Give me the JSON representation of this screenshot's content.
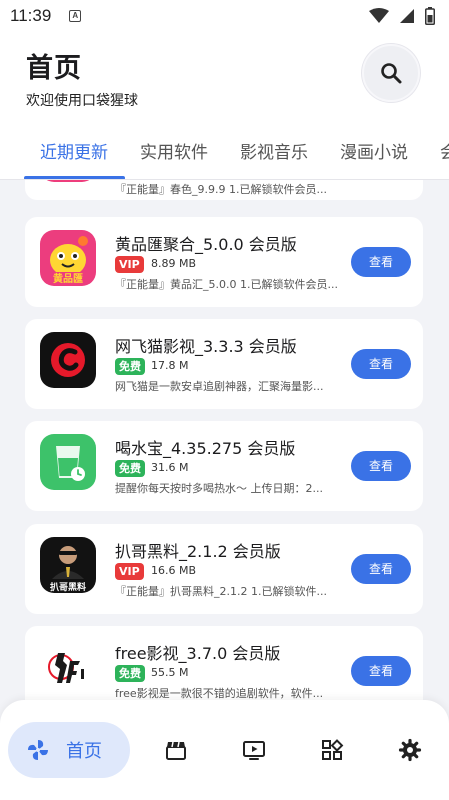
{
  "status_bar": {
    "time": "11:39",
    "indicator": "A"
  },
  "header": {
    "title": "首页",
    "subtitle": "欢迎使用口袋猩球"
  },
  "tabs": [
    {
      "label": "近期更新",
      "active": true
    },
    {
      "label": "实用软件",
      "active": false
    },
    {
      "label": "影视音乐",
      "active": false
    },
    {
      "label": "漫画小说",
      "active": false
    },
    {
      "label": "会",
      "active": false
    }
  ],
  "partial_item": {
    "desc": "『正能量』春色_9.9.9 1.已解锁软件会员..."
  },
  "apps": [
    {
      "name": "黄品匯聚合_5.0.0 会员版",
      "badge": "VIP",
      "badge_type": "vip",
      "size": "8.89 MB",
      "desc": "『正能量』黄品汇_5.0.0 1.已解锁软件会员...",
      "button": "查看",
      "icon": "huangpinhui-app-icon",
      "icon_text": "黄品匯"
    },
    {
      "name": "网飞猫影视_3.3.3 会员版",
      "badge": "免费",
      "badge_type": "free",
      "size": "17.8 M",
      "desc": "网飞猫是一款安卓追剧神器，汇聚海量影...",
      "button": "查看",
      "icon": "netflixcat-app-icon",
      "icon_text": ""
    },
    {
      "name": "喝水宝_4.35.275 会员版",
      "badge": "免费",
      "badge_type": "free",
      "size": "31.6 M",
      "desc": "提醒你每天按时多喝热水～ 上传日期：2...",
      "button": "查看",
      "icon": "water-reminder-app-icon",
      "icon_text": ""
    },
    {
      "name": "扒哥黑料_2.1.2 会员版",
      "badge": "VIP",
      "badge_type": "vip",
      "size": "16.6 MB",
      "desc": "『正能量』扒哥黑料_2.1.2 1.已解锁软件...",
      "button": "查看",
      "icon": "bage-heiliao-app-icon",
      "icon_text": "扒哥黑料"
    },
    {
      "name": "free影视_3.7.0 会员版",
      "badge": "免费",
      "badge_type": "free",
      "size": "55.5 M",
      "desc": "free影视是一款很不错的追剧软件，软件...",
      "button": "查看",
      "icon": "free-video-app-icon",
      "icon_text": ""
    }
  ],
  "bottom_nav": {
    "home_label": "首页",
    "items": [
      "pinwheel-icon",
      "film-box-icon",
      "tv-play-icon",
      "grid-apps-icon",
      "settings-gear-icon"
    ]
  },
  "colors": {
    "accent": "#3a72e6",
    "vip": "#e83a3a",
    "free": "#2db35a",
    "background": "#f2f3f7"
  }
}
